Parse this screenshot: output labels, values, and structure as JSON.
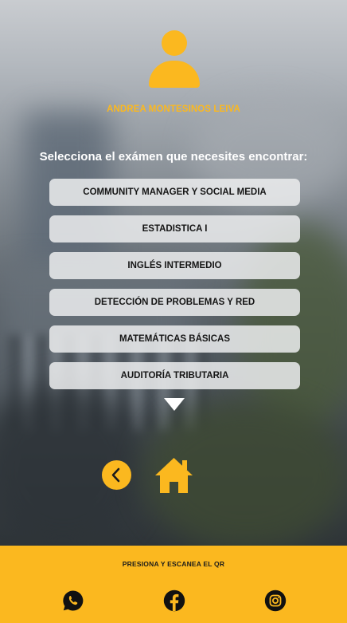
{
  "user": {
    "name": "ANDREA MONTESINOS LEIVA",
    "avatar_icon": "user-avatar-icon"
  },
  "prompt": "Selecciona el exámen que necesites encontrar:",
  "exams": [
    "COMMUNITY MANAGER Y SOCIAL MEDIA",
    "ESTADISTICA I",
    "INGLÉS INTERMEDIO",
    "DETECCIÓN DE PROBLEMAS Y RED",
    "MATEMÁTICAS BÁSICAS",
    "AUDITORÍA TRIBUTARIA"
  ],
  "navigation": {
    "scroll_icon": "triangle-down-icon",
    "back_icon": "chevron-left-icon",
    "home_icon": "home-icon"
  },
  "footer": {
    "text": "PRESIONA Y ESCANEA EL QR",
    "social_icons": [
      "whatsapp-icon",
      "facebook-icon",
      "instagram-icon"
    ]
  },
  "colors": {
    "accent": "#fbb81f",
    "button_bg": "#ebeced",
    "text_dark": "#151515",
    "white": "#ffffff"
  }
}
